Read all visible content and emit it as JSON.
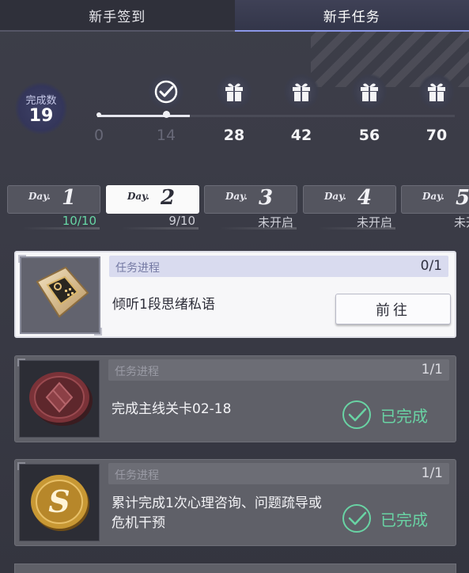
{
  "tabs": {
    "signin": "新手签到",
    "tasks": "新手任务"
  },
  "progress": {
    "count_label": "完成数",
    "count_value": "19",
    "milestones": [
      "0",
      "14",
      "28",
      "42",
      "56",
      "70"
    ],
    "milestone_states": [
      "none",
      "claimed",
      "gift",
      "gift",
      "gift",
      "gift"
    ]
  },
  "days": [
    {
      "label": "Day.",
      "number": "1",
      "status": "10/10"
    },
    {
      "label": "Day.",
      "number": "2",
      "status": "9/10"
    },
    {
      "label": "Day.",
      "number": "3",
      "status": "未开启"
    },
    {
      "label": "Day.",
      "number": "4",
      "status": "未开启"
    },
    {
      "label": "Day.",
      "number": "5",
      "status": "未开启"
    }
  ],
  "tasks": [
    {
      "progress_label": "任务进程",
      "progress": "0/1",
      "title": "倾听1段思绪私语",
      "action": "前往",
      "thumb_icon": "chip-icon"
    },
    {
      "progress_label": "任务进程",
      "progress": "1/1",
      "title": "完成主线关卡02-18",
      "status": "已完成",
      "thumb_icon": "red-coin-icon"
    },
    {
      "progress_label": "任务进程",
      "progress": "1/1",
      "title": "累计完成1次心理咨询、问题疏导或危机干预",
      "status": "已完成",
      "thumb_icon": "gold-coin-icon"
    }
  ],
  "colors": {
    "accent_done": "#69d3a4",
    "tab_active_border": "#8b97e8"
  }
}
